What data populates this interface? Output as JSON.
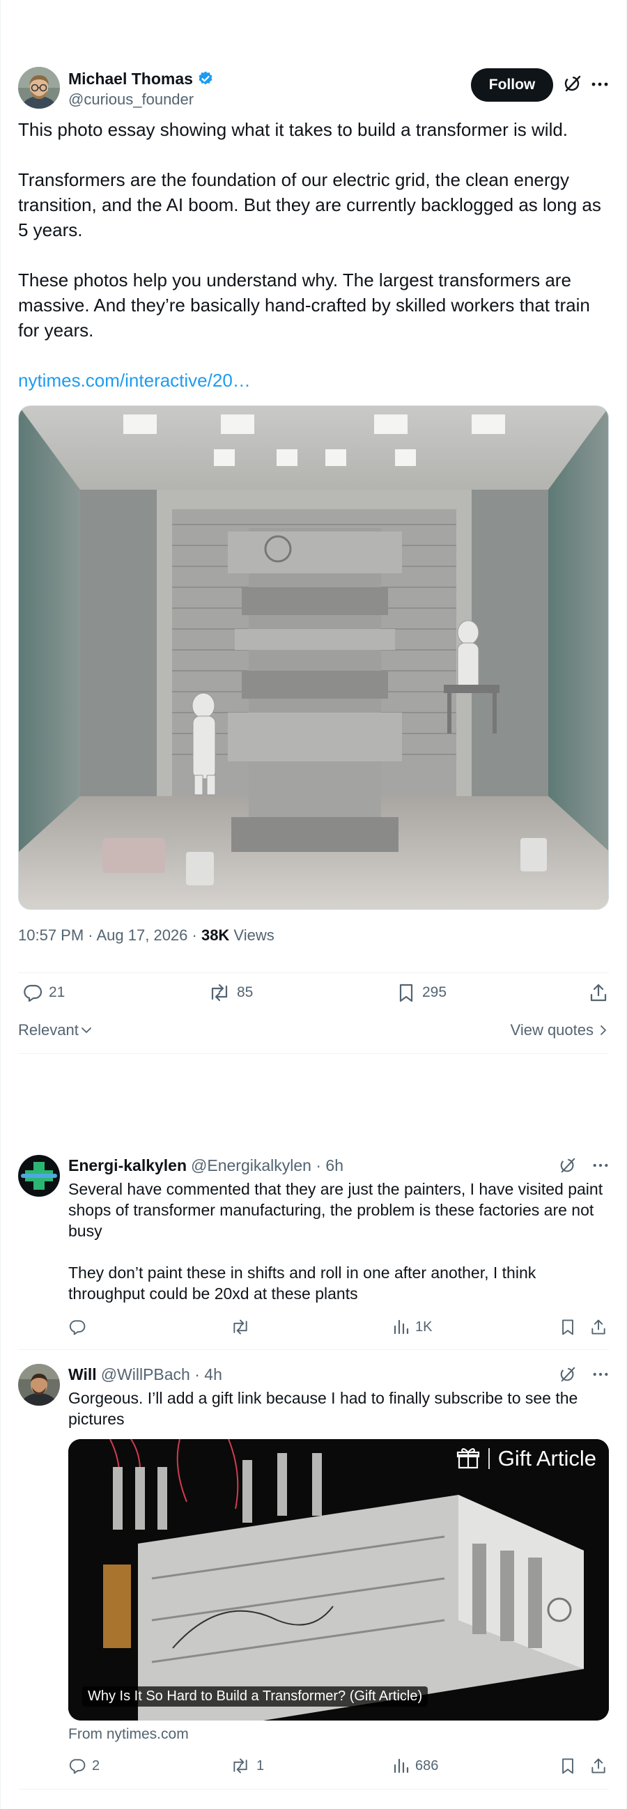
{
  "post": {
    "author_name": "Michael Thomas",
    "author_handle": "@curious_founder",
    "follow_label": "Follow",
    "paragraphs": [
      "This photo essay showing what it takes to build a transformer is wild.",
      "Transformers are the foundation of our electric grid, the clean energy transition, and the AI boom. But they are currently backlogged as long as 5 years.",
      "These photos help you understand why. The largest transformers are massive. And they’re basically hand-crafted by skilled workers that train for years."
    ],
    "link_text": "nytimes.com/interactive/20…",
    "timestamp": "10:57 PM · Aug 17, 2026 · ",
    "views_count": "38K",
    "views_label": " Views",
    "replies": "21",
    "reposts": "85",
    "bookmarks": "295"
  },
  "sort": {
    "relevance_label": "Relevant",
    "view_quotes_label": "View quotes"
  },
  "replies": [
    {
      "name": "Energi-kalkylen",
      "handle": "@Energikalkylen · 6h",
      "paragraphs": [
        "Several have commented that they are just the painters, I have visited paint shops of transformer manufacturing, the problem is these factories are not busy",
        "They don’t paint these in shifts and roll in one after another, I think throughput could be 20xd at these plants"
      ],
      "replies": "",
      "reposts": "",
      "views": "1K"
    },
    {
      "name": "Will",
      "handle": "@WillPBach · 4h",
      "paragraphs": [
        "Gorgeous. I’ll add a gift link because I had to finally subscribe to see the pictures"
      ],
      "card_badge": "Gift Article",
      "card_caption": "Why Is It So Hard to Build a Transformer? (Gift Article)",
      "card_source": "From nytimes.com",
      "replies": "2",
      "reposts": "1",
      "views": "686"
    }
  ],
  "colors": {
    "accent": "#1d9bf0",
    "text": "#0f1419",
    "secondary": "#536471",
    "divider": "#eff3f4"
  }
}
